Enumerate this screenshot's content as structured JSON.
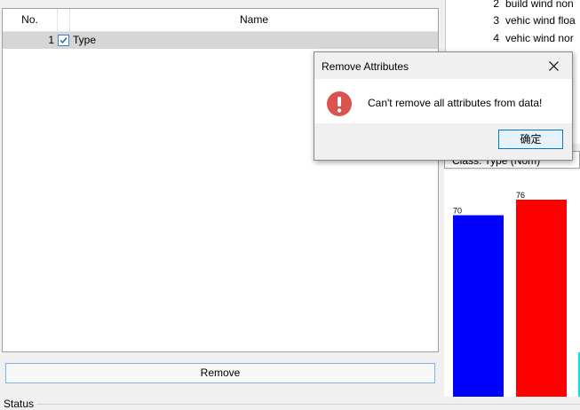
{
  "attributes_table": {
    "headers": {
      "no": "No.",
      "name": "Name"
    },
    "rows": [
      {
        "no": "1",
        "checked": true,
        "name": "Type"
      }
    ]
  },
  "remove_button": "Remove",
  "status": {
    "label": "Status"
  },
  "instances": [
    {
      "num": "2",
      "text": "build wind non"
    },
    {
      "num": "3",
      "text": "vehic wind floa"
    },
    {
      "num": "4",
      "text": "vehic wind nor"
    }
  ],
  "class_selector": "Class: Type (Nom)",
  "chart_data": {
    "type": "bar",
    "categories": [
      "",
      ""
    ],
    "values": [
      70,
      76
    ],
    "colors": [
      "#0000ff",
      "#ff0000"
    ],
    "data_labels": [
      "70",
      "76"
    ]
  },
  "dialog": {
    "title": "Remove Attributes",
    "message": "Can't remove all attributes from data!",
    "ok_label": "确定",
    "icon": "error-icon",
    "icon_color": "#d9534f"
  }
}
